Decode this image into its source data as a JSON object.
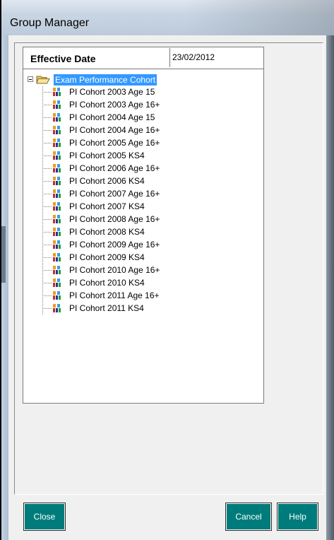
{
  "window": {
    "title": "Group Manager"
  },
  "effective_date": {
    "label": "Effective Date",
    "value": "23/02/2012"
  },
  "tree": {
    "root": {
      "label": "Exam Performance Cohort",
      "icon": "folder-open-icon"
    },
    "items": [
      {
        "label": "PI Cohort 2003 Age 15"
      },
      {
        "label": "PI Cohort 2003 Age 16+"
      },
      {
        "label": "PI Cohort 2004 Age 15"
      },
      {
        "label": "PI Cohort 2004 Age 16+"
      },
      {
        "label": "PI Cohort 2005 Age 16+"
      },
      {
        "label": "PI Cohort 2005 KS4"
      },
      {
        "label": "PI Cohort 2006 Age 16+"
      },
      {
        "label": "PI Cohort 2006 KS4"
      },
      {
        "label": "PI Cohort 2007 Age 16+"
      },
      {
        "label": "PI Cohort 2007 KS4"
      },
      {
        "label": "PI Cohort 2008 Age 16+"
      },
      {
        "label": "PI Cohort 2008 KS4"
      },
      {
        "label": "PI Cohort 2009 Age 16+"
      },
      {
        "label": "PI Cohort 2009 KS4"
      },
      {
        "label": "PI Cohort 2010 Age 16+"
      },
      {
        "label": "PI Cohort 2010 KS4"
      },
      {
        "label": "PI Cohort 2011 Age 16+"
      },
      {
        "label": "PI Cohort 2011 KS4"
      }
    ]
  },
  "buttons": {
    "close": "Close",
    "cancel": "Cancel",
    "help": "Help"
  },
  "colors": {
    "button_bg": "#007b7b",
    "selection": "#3399ff"
  }
}
